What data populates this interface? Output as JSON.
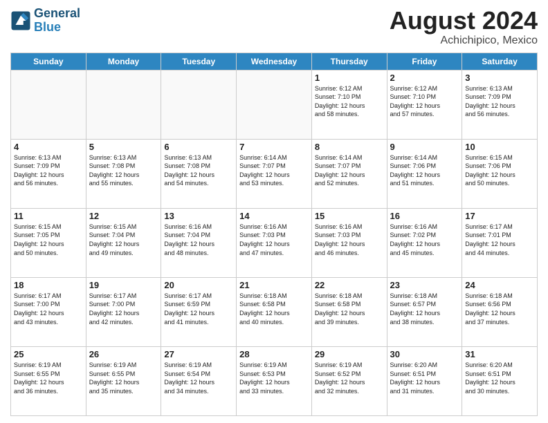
{
  "header": {
    "logo_line1": "General",
    "logo_line2": "Blue",
    "month": "August 2024",
    "location": "Achichipico, Mexico"
  },
  "days_of_week": [
    "Sunday",
    "Monday",
    "Tuesday",
    "Wednesday",
    "Thursday",
    "Friday",
    "Saturday"
  ],
  "weeks": [
    [
      {
        "day": "",
        "info": ""
      },
      {
        "day": "",
        "info": ""
      },
      {
        "day": "",
        "info": ""
      },
      {
        "day": "",
        "info": ""
      },
      {
        "day": "1",
        "sunrise": "6:12 AM",
        "sunset": "7:10 PM",
        "daylight": "12 hours and 58 minutes."
      },
      {
        "day": "2",
        "sunrise": "6:12 AM",
        "sunset": "7:10 PM",
        "daylight": "12 hours and 57 minutes."
      },
      {
        "day": "3",
        "sunrise": "6:13 AM",
        "sunset": "7:09 PM",
        "daylight": "12 hours and 56 minutes."
      }
    ],
    [
      {
        "day": "4",
        "sunrise": "6:13 AM",
        "sunset": "7:09 PM",
        "daylight": "12 hours and 56 minutes."
      },
      {
        "day": "5",
        "sunrise": "6:13 AM",
        "sunset": "7:08 PM",
        "daylight": "12 hours and 55 minutes."
      },
      {
        "day": "6",
        "sunrise": "6:13 AM",
        "sunset": "7:08 PM",
        "daylight": "12 hours and 54 minutes."
      },
      {
        "day": "7",
        "sunrise": "6:14 AM",
        "sunset": "7:07 PM",
        "daylight": "12 hours and 53 minutes."
      },
      {
        "day": "8",
        "sunrise": "6:14 AM",
        "sunset": "7:07 PM",
        "daylight": "12 hours and 52 minutes."
      },
      {
        "day": "9",
        "sunrise": "6:14 AM",
        "sunset": "7:06 PM",
        "daylight": "12 hours and 51 minutes."
      },
      {
        "day": "10",
        "sunrise": "6:15 AM",
        "sunset": "7:06 PM",
        "daylight": "12 hours and 50 minutes."
      }
    ],
    [
      {
        "day": "11",
        "sunrise": "6:15 AM",
        "sunset": "7:05 PM",
        "daylight": "12 hours and 50 minutes."
      },
      {
        "day": "12",
        "sunrise": "6:15 AM",
        "sunset": "7:04 PM",
        "daylight": "12 hours and 49 minutes."
      },
      {
        "day": "13",
        "sunrise": "6:16 AM",
        "sunset": "7:04 PM",
        "daylight": "12 hours and 48 minutes."
      },
      {
        "day": "14",
        "sunrise": "6:16 AM",
        "sunset": "7:03 PM",
        "daylight": "12 hours and 47 minutes."
      },
      {
        "day": "15",
        "sunrise": "6:16 AM",
        "sunset": "7:03 PM",
        "daylight": "12 hours and 46 minutes."
      },
      {
        "day": "16",
        "sunrise": "6:16 AM",
        "sunset": "7:02 PM",
        "daylight": "12 hours and 45 minutes."
      },
      {
        "day": "17",
        "sunrise": "6:17 AM",
        "sunset": "7:01 PM",
        "daylight": "12 hours and 44 minutes."
      }
    ],
    [
      {
        "day": "18",
        "sunrise": "6:17 AM",
        "sunset": "7:00 PM",
        "daylight": "12 hours and 43 minutes."
      },
      {
        "day": "19",
        "sunrise": "6:17 AM",
        "sunset": "7:00 PM",
        "daylight": "12 hours and 42 minutes."
      },
      {
        "day": "20",
        "sunrise": "6:17 AM",
        "sunset": "6:59 PM",
        "daylight": "12 hours and 41 minutes."
      },
      {
        "day": "21",
        "sunrise": "6:18 AM",
        "sunset": "6:58 PM",
        "daylight": "12 hours and 40 minutes."
      },
      {
        "day": "22",
        "sunrise": "6:18 AM",
        "sunset": "6:58 PM",
        "daylight": "12 hours and 39 minutes."
      },
      {
        "day": "23",
        "sunrise": "6:18 AM",
        "sunset": "6:57 PM",
        "daylight": "12 hours and 38 minutes."
      },
      {
        "day": "24",
        "sunrise": "6:18 AM",
        "sunset": "6:56 PM",
        "daylight": "12 hours and 37 minutes."
      }
    ],
    [
      {
        "day": "25",
        "sunrise": "6:19 AM",
        "sunset": "6:55 PM",
        "daylight": "12 hours and 36 minutes."
      },
      {
        "day": "26",
        "sunrise": "6:19 AM",
        "sunset": "6:55 PM",
        "daylight": "12 hours and 35 minutes."
      },
      {
        "day": "27",
        "sunrise": "6:19 AM",
        "sunset": "6:54 PM",
        "daylight": "12 hours and 34 minutes."
      },
      {
        "day": "28",
        "sunrise": "6:19 AM",
        "sunset": "6:53 PM",
        "daylight": "12 hours and 33 minutes."
      },
      {
        "day": "29",
        "sunrise": "6:19 AM",
        "sunset": "6:52 PM",
        "daylight": "12 hours and 32 minutes."
      },
      {
        "day": "30",
        "sunrise": "6:20 AM",
        "sunset": "6:51 PM",
        "daylight": "12 hours and 31 minutes."
      },
      {
        "day": "31",
        "sunrise": "6:20 AM",
        "sunset": "6:51 PM",
        "daylight": "12 hours and 30 minutes."
      }
    ]
  ]
}
